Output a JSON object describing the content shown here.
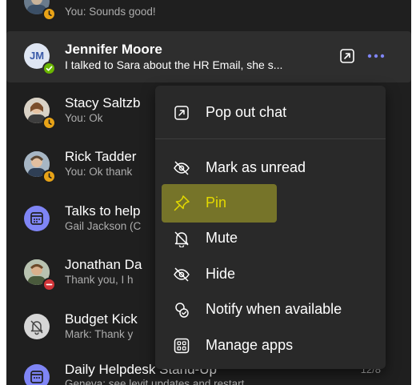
{
  "chats": [
    {
      "preview": "You: Sounds good!",
      "status": "away"
    },
    {
      "initials": "JM",
      "name": "Jennifer Moore",
      "preview": "I talked to Sara about the HR Email, she s...",
      "status": "available",
      "selected": true
    },
    {
      "name": "Stacy Saltzb",
      "preview": "You: Ok",
      "status": "away"
    },
    {
      "name": "Rick Tadder",
      "preview": "You: Ok thank",
      "status": "away"
    },
    {
      "name": "Talks to help",
      "preview": "Gail Jackson (C"
    },
    {
      "name": "Jonathan Da",
      "preview": "Thank you, I h",
      "status": "busy"
    },
    {
      "name": "Budget Kick",
      "preview": "Mark: Thank y"
    },
    {
      "name": "Daily Helpdesk Stand-Up",
      "preview": "Geneva: see levit updates and restart",
      "time": "12/8"
    }
  ],
  "context_menu": {
    "items": [
      {
        "label": "Pop out chat",
        "icon": "pop-out-icon"
      },
      {
        "label": "Mark as unread",
        "icon": "unread-icon"
      },
      {
        "label": "Pin",
        "icon": "pin-icon",
        "highlighted": true
      },
      {
        "label": "Mute",
        "icon": "mute-icon"
      },
      {
        "label": "Hide",
        "icon": "hide-icon"
      },
      {
        "label": "Notify when available",
        "icon": "notify-icon"
      },
      {
        "label": "Manage apps",
        "icon": "apps-icon"
      }
    ]
  },
  "colors": {
    "background": "#1f1f1f",
    "selected_row": "#2e2e2e",
    "menu": "#292929",
    "accent": "#7f85f5",
    "pin": "#e3d900",
    "highlight": "#b7b22a",
    "status_away": "#e8a317",
    "status_available": "#6bb700",
    "status_busy": "#d13438"
  }
}
